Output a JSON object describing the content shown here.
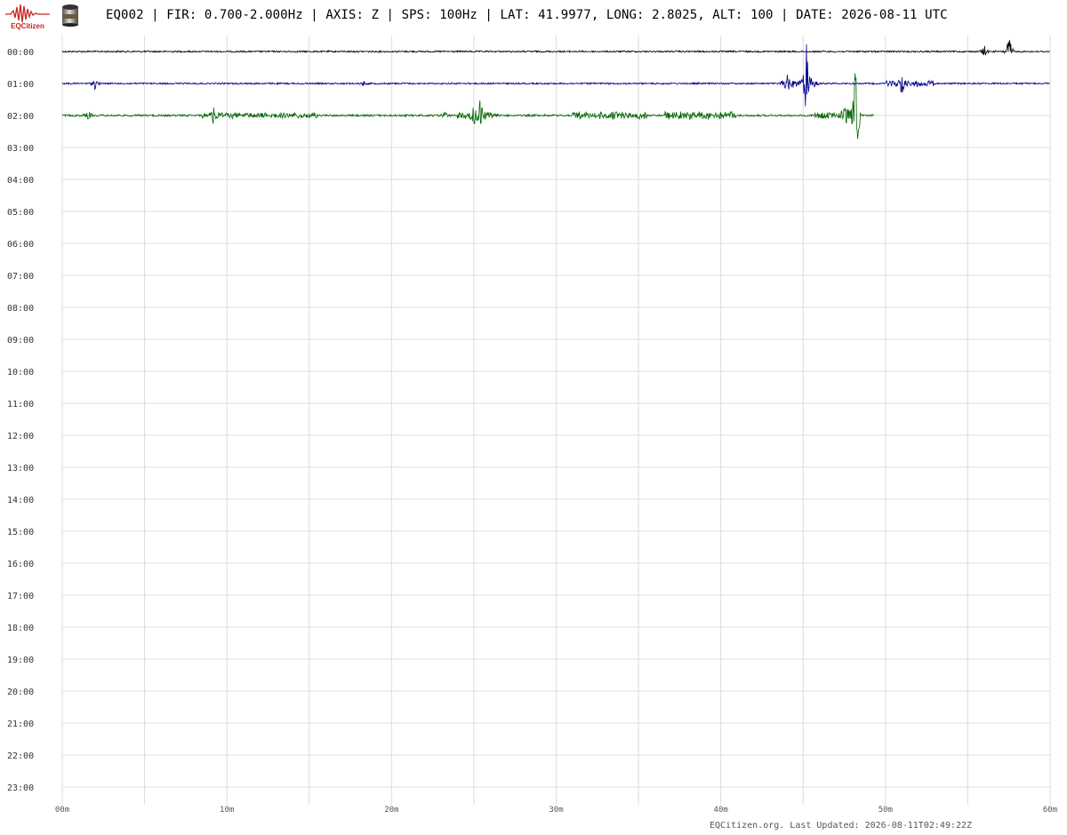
{
  "header": {
    "logo_text": "EQCitizen",
    "title": "EQ002 | FIR: 0.700-2.000Hz | AXIS: Z | SPS: 100Hz | LAT: 41.9977, LONG: 2.8025, ALT: 100 | DATE: 2026-08-11 UTC"
  },
  "icons": {
    "logo": "seismograph-logo-icon",
    "sensor": "seismometer-sensor-icon"
  },
  "colors": {
    "trace_00": "#000000",
    "trace_01": "#00008b",
    "trace_02": "#006400",
    "grid": "#dcdcdc",
    "logo": "#cc2222"
  },
  "chart_data": {
    "type": "line",
    "title": "",
    "xlabel": "",
    "ylabel": "",
    "xlim": [
      0,
      60
    ],
    "x_tick_labels": [
      "00m",
      "10m",
      "20m",
      "30m",
      "40m",
      "50m",
      "60m"
    ],
    "x_minor_step_minutes": 5,
    "row_labels": [
      "00:00",
      "01:00",
      "02:00",
      "03:00",
      "04:00",
      "05:00",
      "06:00",
      "07:00",
      "08:00",
      "09:00",
      "10:00",
      "11:00",
      "12:00",
      "13:00",
      "14:00",
      "15:00",
      "16:00",
      "17:00",
      "18:00",
      "19:00",
      "20:00",
      "21:00",
      "22:00",
      "23:00"
    ],
    "grid": true,
    "series": [
      {
        "row": 0,
        "color": "#000000",
        "end_minute": 60,
        "noise": 0.9,
        "events": [
          {
            "minute": 56.0,
            "amp": 7
          },
          {
            "minute": 57.5,
            "amp": 22
          }
        ],
        "bursts": []
      },
      {
        "row": 1,
        "color": "#00008b",
        "end_minute": 60,
        "noise": 0.9,
        "events": [
          {
            "minute": 2.0,
            "amp": 7
          },
          {
            "minute": 18.3,
            "amp": 3
          },
          {
            "minute": 44.0,
            "amp": 10
          },
          {
            "minute": 45.2,
            "amp": 42
          },
          {
            "minute": 51.0,
            "amp": 12
          }
        ],
        "bursts": [
          {
            "start": 43.5,
            "end": 46.0,
            "amp": 4
          },
          {
            "start": 50.0,
            "end": 53.0,
            "amp": 3
          }
        ]
      },
      {
        "row": 2,
        "color": "#006400",
        "end_minute": 49.3,
        "noise": 1.1,
        "events": [
          {
            "minute": 1.6,
            "amp": 5
          },
          {
            "minute": 9.2,
            "amp": 9
          },
          {
            "minute": 23.2,
            "amp": 6
          },
          {
            "minute": 25.0,
            "amp": 10
          },
          {
            "minute": 25.4,
            "amp": 20
          },
          {
            "minute": 47.6,
            "amp": 14
          },
          {
            "minute": 48.2,
            "amp": 70
          }
        ],
        "bursts": [
          {
            "start": 8.5,
            "end": 15.5,
            "amp": 2.5
          },
          {
            "start": 24.0,
            "end": 26.5,
            "amp": 3
          },
          {
            "start": 31.0,
            "end": 35.5,
            "amp": 3.5
          },
          {
            "start": 36.5,
            "end": 41.0,
            "amp": 4
          },
          {
            "start": 45.5,
            "end": 48.5,
            "amp": 3
          }
        ]
      }
    ]
  },
  "footer": {
    "text": "EQCitizen.org. Last Updated: 2026-08-11T02:49:22Z"
  }
}
